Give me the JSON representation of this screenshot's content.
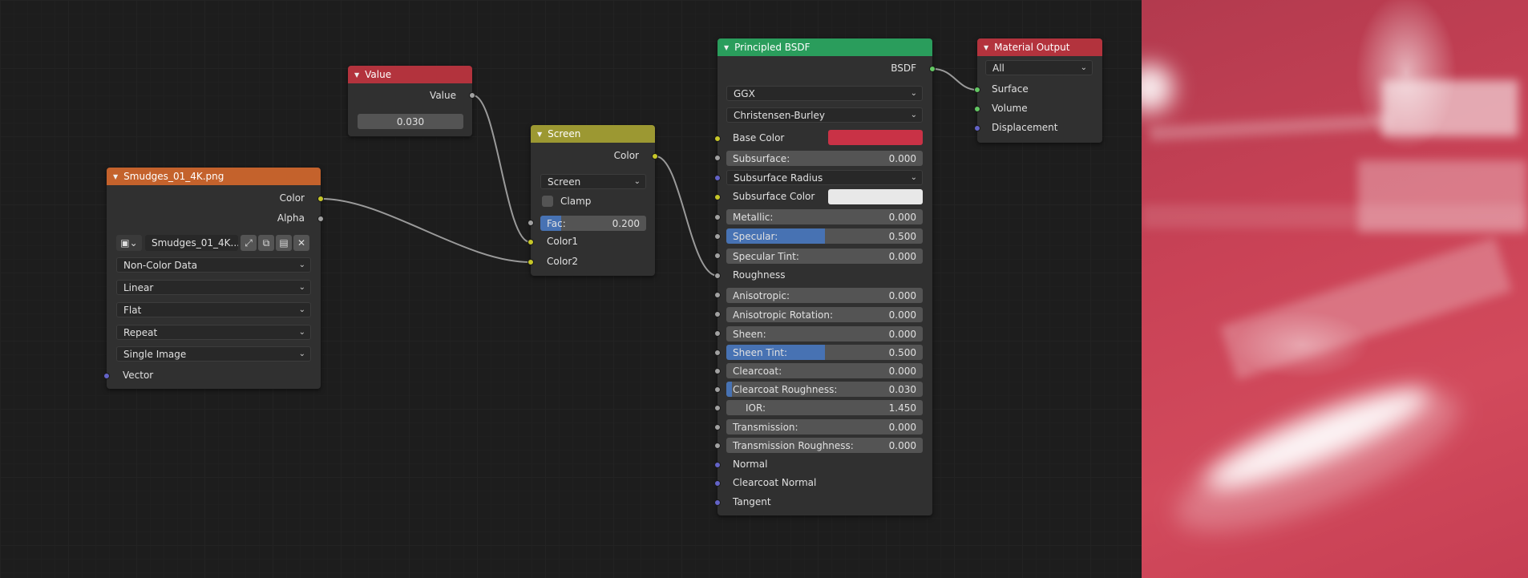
{
  "nodes": {
    "value": {
      "title": "Value",
      "output_label": "Value",
      "field_value": "0.030",
      "header_color": "#b3333d"
    },
    "image": {
      "title": "Smudges_01_4K.png",
      "header_color": "#c4622c",
      "out_color": "Color",
      "out_alpha": "Alpha",
      "image_name": "Smudges_01_4K...",
      "color_space": "Non-Color Data",
      "interpolation": "Linear",
      "projection": "Flat",
      "extension": "Repeat",
      "source": "Single Image",
      "in_vector": "Vector"
    },
    "screen": {
      "title": "Screen",
      "header_color": "#9c9832",
      "out_color": "Color",
      "blend_mode": "Screen",
      "clamp_label": "Clamp",
      "fac_label": "Fac:",
      "fac_value": "0.200",
      "fac_fraction": 0.2,
      "in_color1": "Color1",
      "in_color2": "Color2"
    },
    "bsdf": {
      "title": "Principled BSDF",
      "header_color": "#2a9d5c",
      "out_bsdf": "BSDF",
      "distribution": "GGX",
      "subsurface_method": "Christensen-Burley",
      "base_color_label": "Base Color",
      "base_color": "#c93246",
      "subsurface_label": "Subsurface:",
      "subsurface_value": "0.000",
      "subsurface_radius_label": "Subsurface Radius",
      "subsurface_color_label": "Subsurface Color",
      "subsurface_color": "#e8e8e8",
      "metallic_label": "Metallic:",
      "metallic_value": "0.000",
      "specular_label": "Specular:",
      "specular_value": "0.500",
      "specular_fraction": 0.5,
      "specular_tint_label": "Specular Tint:",
      "specular_tint_value": "0.000",
      "roughness_label": "Roughness",
      "anisotropic_label": "Anisotropic:",
      "anisotropic_value": "0.000",
      "anisotropic_rotation_label": "Anisotropic Rotation:",
      "anisotropic_rotation_value": "0.000",
      "sheen_label": "Sheen:",
      "sheen_value": "0.000",
      "sheen_tint_label": "Sheen Tint:",
      "sheen_tint_value": "0.500",
      "sheen_tint_fraction": 0.5,
      "clearcoat_label": "Clearcoat:",
      "clearcoat_value": "0.000",
      "clearcoat_roughness_label": "Clearcoat Roughness:",
      "clearcoat_roughness_value": "0.030",
      "clearcoat_roughness_fraction": 0.03,
      "ior_label": "IOR:",
      "ior_value": "1.450",
      "transmission_label": "Transmission:",
      "transmission_value": "0.000",
      "transmission_roughness_label": "Transmission Roughness:",
      "transmission_roughness_value": "0.000",
      "normal_label": "Normal",
      "clearcoat_normal_label": "Clearcoat Normal",
      "tangent_label": "Tangent"
    },
    "output": {
      "title": "Material Output",
      "header_color": "#b3333d",
      "target": "All",
      "surface_label": "Surface",
      "volume_label": "Volume",
      "displacement_label": "Displacement"
    }
  },
  "colors": {
    "socket_color": "#c7c729",
    "socket_float": "#a1a1a1",
    "socket_vector": "#6363c7",
    "socket_shader": "#63c763",
    "slider_fill": "#4772b3",
    "link": "#9a9a9a",
    "viewport_base": "#c94256"
  }
}
